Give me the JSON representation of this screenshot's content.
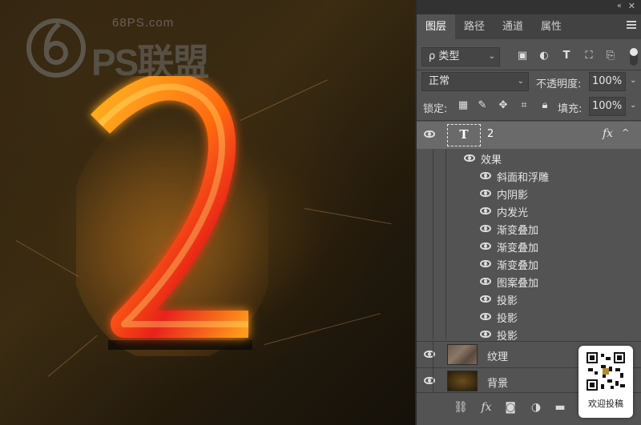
{
  "watermark": {
    "site": "68PS.com",
    "brand": "PS联盟"
  },
  "canvas": {
    "glyph": "2"
  },
  "panel": {
    "tabs": [
      {
        "label": "图层",
        "active": true
      },
      {
        "label": "路径",
        "active": false
      },
      {
        "label": "通道",
        "active": false
      },
      {
        "label": "属性",
        "active": false
      }
    ],
    "filter": {
      "kind_label": "ρ 类型",
      "icons": [
        "image-filter-icon",
        "adjustment-filter-icon",
        "type-filter-icon",
        "shape-filter-icon",
        "smart-object-filter-icon"
      ]
    },
    "blend": {
      "mode": "正常",
      "opacity_label": "不透明度:",
      "opacity_value": "100%"
    },
    "lock": {
      "label": "锁定:",
      "icons": [
        "lock-transparent-pixels-icon",
        "lock-image-pixels-icon",
        "lock-position-icon",
        "lock-artboard-icon",
        "lock-all-icon"
      ],
      "fill_label": "填充:",
      "fill_value": "100%"
    },
    "layers": [
      {
        "name": "2",
        "type": "text",
        "thumb_glyph": "T",
        "fx": "fx",
        "selected": true,
        "effects_label": "效果",
        "effects": [
          "斜面和浮雕",
          "内阴影",
          "内发光",
          "渐变叠加",
          "渐变叠加",
          "渐变叠加",
          "图案叠加",
          "投影",
          "投影",
          "投影"
        ]
      },
      {
        "name": "纹理",
        "type": "pixel",
        "selected": false
      },
      {
        "name": "背景",
        "type": "pixel",
        "selected": false
      }
    ],
    "bottom_icons": [
      "link-layers-icon",
      "fx-icon",
      "add-mask-icon",
      "adjustment-layer-icon",
      "new-group-icon"
    ]
  },
  "qr_card": {
    "caption": "欢迎投稿"
  },
  "colors": {
    "panel_bg": "#535353",
    "tab_bar": "#424242",
    "selected_layer": "#6a6a6a",
    "glyph_orange": "#ff9a1a",
    "glyph_red": "#e8221a"
  }
}
